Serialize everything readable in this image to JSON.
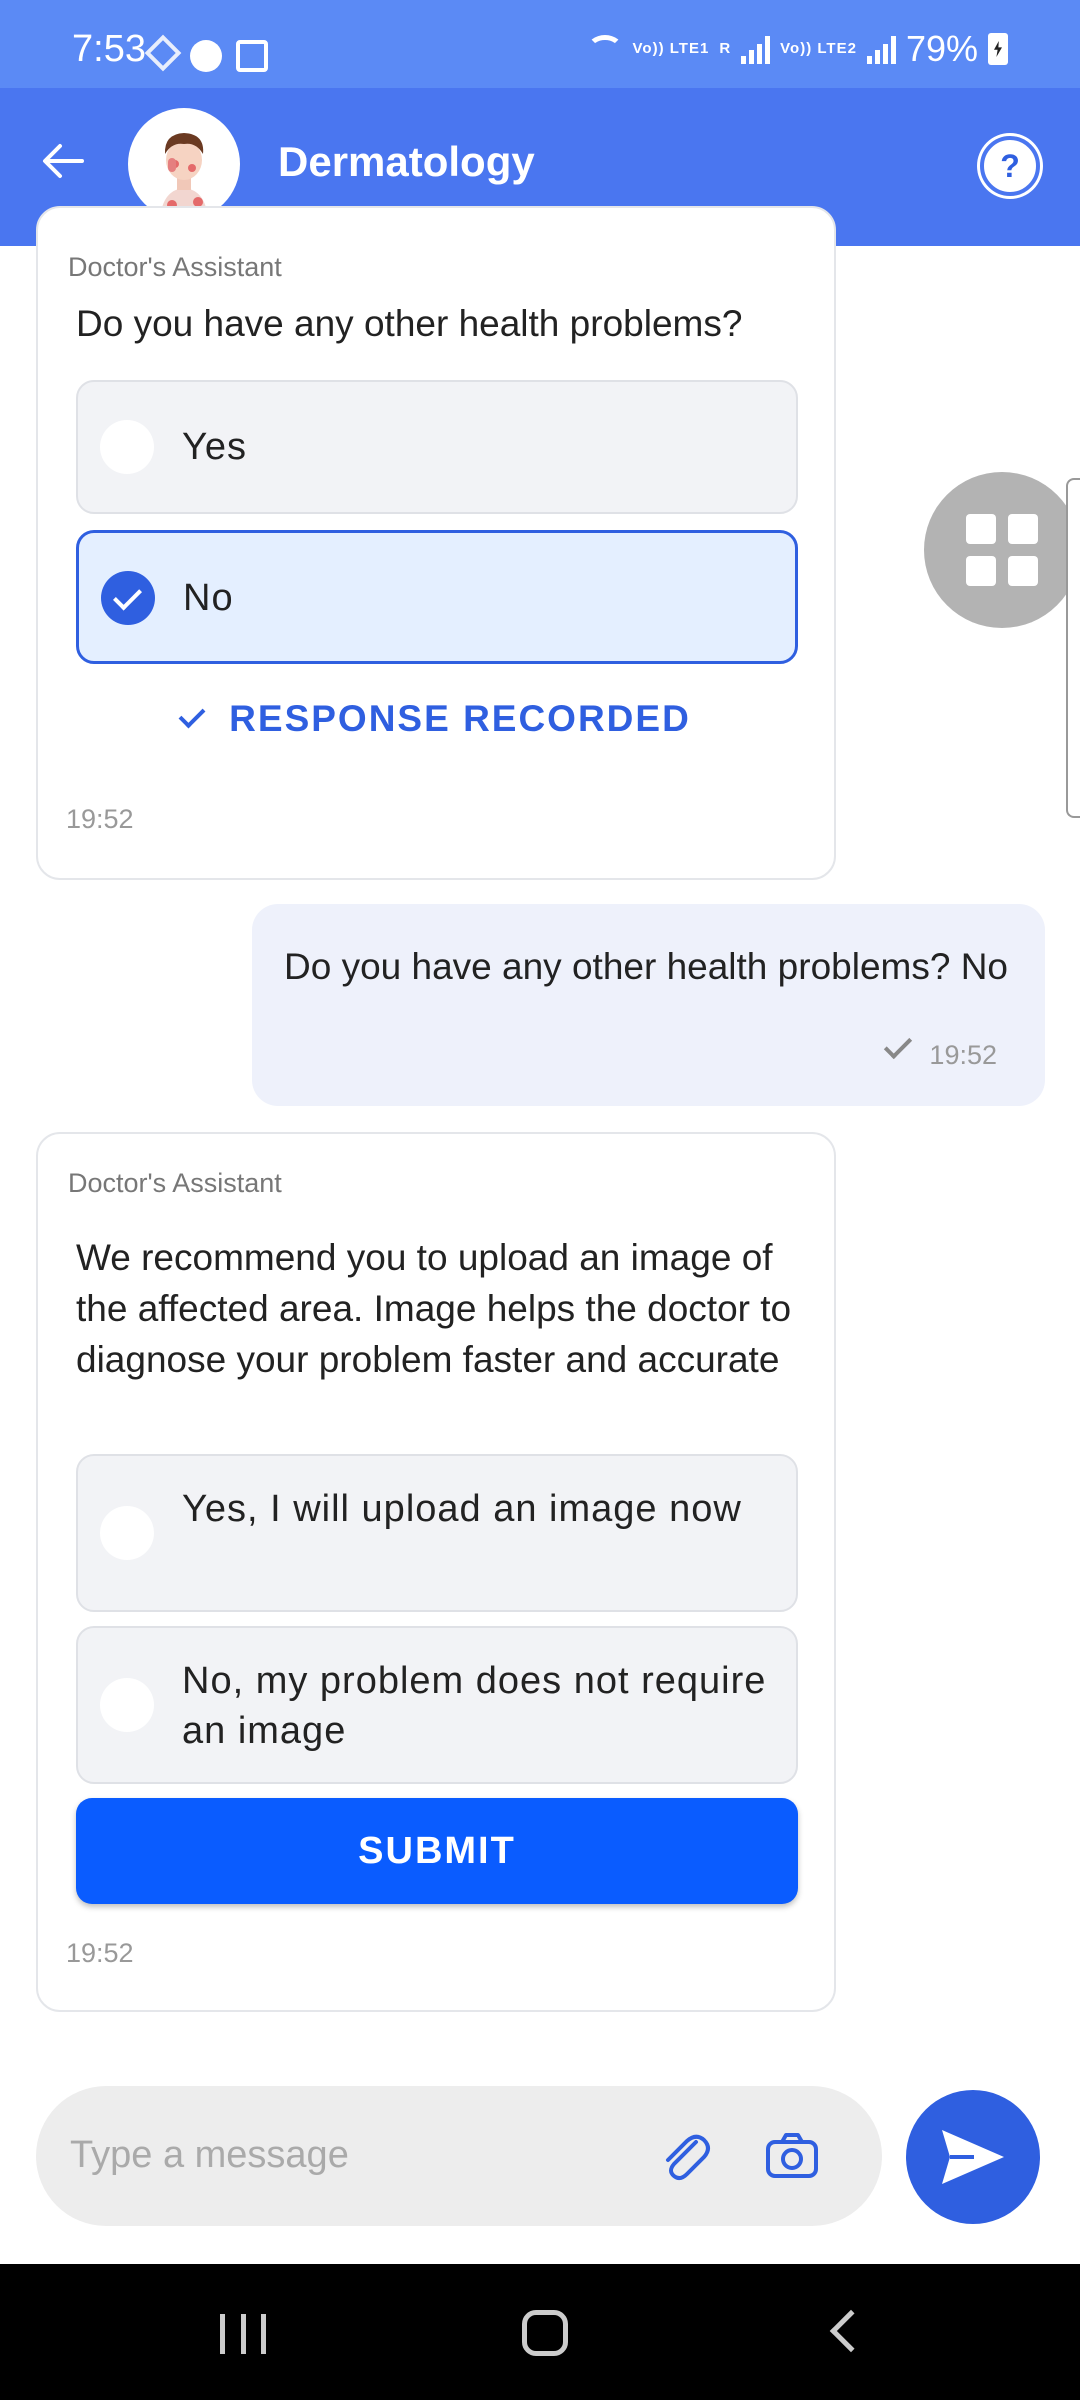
{
  "status_bar": {
    "time": "7:53",
    "signal_label_1": "Vo)) LTE1",
    "signal_label_1_r": "R",
    "signal_label_2": "Vo)) LTE2",
    "battery": "79%"
  },
  "app_bar": {
    "title": "Dermatology",
    "help_label": "?"
  },
  "messages": [
    {
      "sender": "Doctor's Assistant",
      "question": "Do you have any other health problems?",
      "options": [
        {
          "label": "Yes",
          "selected": false
        },
        {
          "label": "No",
          "selected": true
        }
      ],
      "status": "RESPONSE RECORDED",
      "time": "19:52"
    },
    {
      "text": "Do you have any other health problems? No",
      "time": "19:52"
    },
    {
      "sender": "Doctor's Assistant",
      "question": "We recommend you to upload an image of the affected area. Image helps the doctor to diagnose your problem faster and accurate",
      "options": [
        {
          "label": "Yes, I will upload an image now",
          "selected": false
        },
        {
          "label": "No, my problem does not require an image",
          "selected": false
        }
      ],
      "submit_label": "SUBMIT",
      "time": "19:52"
    }
  ],
  "composer": {
    "placeholder": "Type a message"
  },
  "colors": {
    "status_bar": "#5b8af5",
    "app_bar": "#4a76f0",
    "accent": "#2f5fe0",
    "submit": "#0a5cff"
  }
}
